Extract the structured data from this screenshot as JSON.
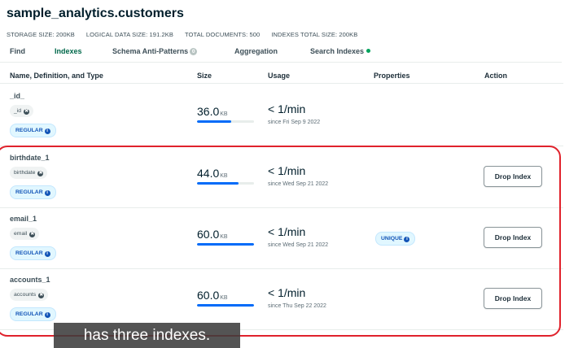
{
  "title": "sample_analytics.customers",
  "stats": [
    {
      "label": "STORAGE SIZE:",
      "value": "200KB"
    },
    {
      "label": "LOGICAL DATA SIZE:",
      "value": "191.2KB"
    },
    {
      "label": "TOTAL DOCUMENTS:",
      "value": "500"
    },
    {
      "label": "INDEXES TOTAL SIZE:",
      "value": "200KB"
    }
  ],
  "tabs": [
    {
      "label": "Find"
    },
    {
      "label": "Indexes"
    },
    {
      "label": "Schema Anti-Patterns",
      "badge": "0"
    },
    {
      "label": "Aggregation"
    },
    {
      "label": "Search Indexes"
    }
  ],
  "active_tab": "Indexes",
  "table": {
    "headers": [
      "Name, Definition, and Type",
      "Size",
      "Usage",
      "Properties",
      "Action"
    ],
    "rows": [
      {
        "name": "_id_",
        "field": "_id",
        "type": "REGULAR",
        "size": "36.0",
        "size_unit": "KB",
        "size_fraction": 0.6,
        "usage": "< 1/min",
        "since": "since Fri Sep 9 2022",
        "property": "",
        "action": ""
      },
      {
        "name": "birthdate_1",
        "field": "birthdate",
        "type": "REGULAR",
        "size": "44.0",
        "size_unit": "KB",
        "size_fraction": 0.73,
        "usage": "< 1/min",
        "since": "since Wed Sep 21 2022",
        "property": "",
        "action": "Drop Index"
      },
      {
        "name": "email_1",
        "field": "email",
        "type": "REGULAR",
        "size": "60.0",
        "size_unit": "KB",
        "size_fraction": 1.0,
        "usage": "< 1/min",
        "since": "since Wed Sep 21 2022",
        "property": "UNIQUE",
        "action": "Drop Index"
      },
      {
        "name": "accounts_1",
        "field": "accounts",
        "type": "REGULAR",
        "size": "60.0",
        "size_unit": "KB",
        "size_fraction": 1.0,
        "usage": "< 1/min",
        "since": "since Thu Sep 22 2022",
        "property": "",
        "action": "Drop Index"
      }
    ]
  },
  "caption": "has three indexes.",
  "colors": {
    "accent": "#00684a",
    "bar": "#016bf8",
    "highlight": "#e0222c"
  }
}
